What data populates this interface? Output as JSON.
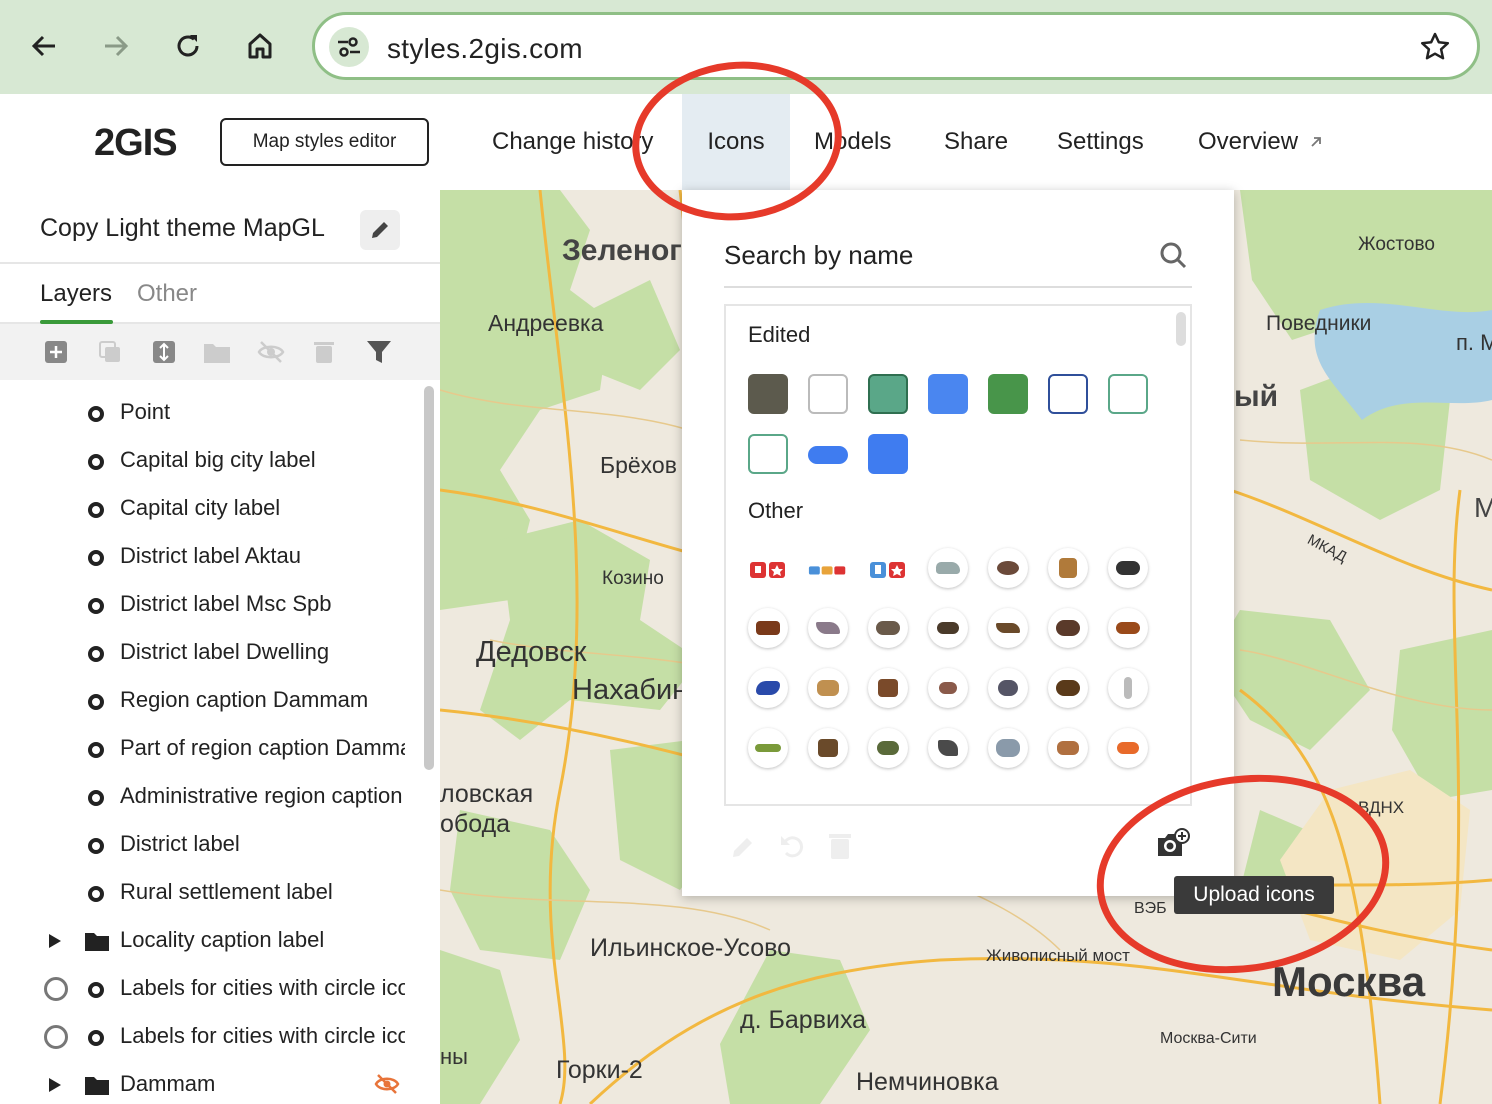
{
  "browser": {
    "url": "styles.2gis.com"
  },
  "header": {
    "logo": "2GIS",
    "editor_button": "Map styles editor",
    "tabs": [
      {
        "label": "Change history"
      },
      {
        "label": "Icons"
      },
      {
        "label": "Models"
      },
      {
        "label": "Share"
      },
      {
        "label": "Settings"
      },
      {
        "label": "Overview"
      }
    ]
  },
  "sidebar": {
    "style_title": "Copy Light theme MapGL",
    "subtabs": [
      {
        "label": "Layers"
      },
      {
        "label": "Other"
      }
    ],
    "layers": [
      {
        "label": "Point"
      },
      {
        "label": "Capital big city label"
      },
      {
        "label": "Capital city label"
      },
      {
        "label": "District label Aktau"
      },
      {
        "label": "District label Msc Spb"
      },
      {
        "label": "District label Dwelling"
      },
      {
        "label": "Region caption Dammam"
      },
      {
        "label": "Part of region caption Dammam"
      },
      {
        "label": "Administrative region caption"
      },
      {
        "label": "District label"
      },
      {
        "label": "Rural settlement label"
      },
      {
        "label": "Locality caption label"
      },
      {
        "label": "Labels for cities with circle icon"
      },
      {
        "label": "Labels for cities with circle icon"
      },
      {
        "label": "Dammam"
      }
    ]
  },
  "icons_panel": {
    "search_placeholder": "Search by name",
    "section_edited": "Edited",
    "section_other": "Other",
    "upload_tooltip": "Upload icons",
    "swatch_colors": [
      "#5c5a4d",
      "#ffffff",
      "#5aa788",
      "#4a86f0",
      "#48954a",
      "#ffffff",
      "#ffffff",
      "#ffffff",
      "#3f7cf0",
      "#3f7cf0"
    ]
  },
  "map": {
    "places": [
      {
        "name": "Зеленог"
      },
      {
        "name": "Андреевка"
      },
      {
        "name": "Брёхов"
      },
      {
        "name": "Козино"
      },
      {
        "name": "Дедовск"
      },
      {
        "name": "Нахабин"
      },
      {
        "name": "ловская"
      },
      {
        "name": "ободa"
      },
      {
        "name": "Ильинское-Усово"
      },
      {
        "name": "д. Барвиха"
      },
      {
        "name": "Горки-2"
      },
      {
        "name": "Немчиновка"
      },
      {
        "name": "ны"
      },
      {
        "name": "Жостово"
      },
      {
        "name": "Поведники"
      },
      {
        "name": "п. М"
      },
      {
        "name": "ый"
      },
      {
        "name": "М"
      },
      {
        "name": "МКАД"
      },
      {
        "name": "ВДНХ"
      },
      {
        "name": "ВЭБ"
      },
      {
        "name": "Живописный мост"
      },
      {
        "name": "Москва"
      },
      {
        "name": "Москва-Сити"
      }
    ]
  }
}
